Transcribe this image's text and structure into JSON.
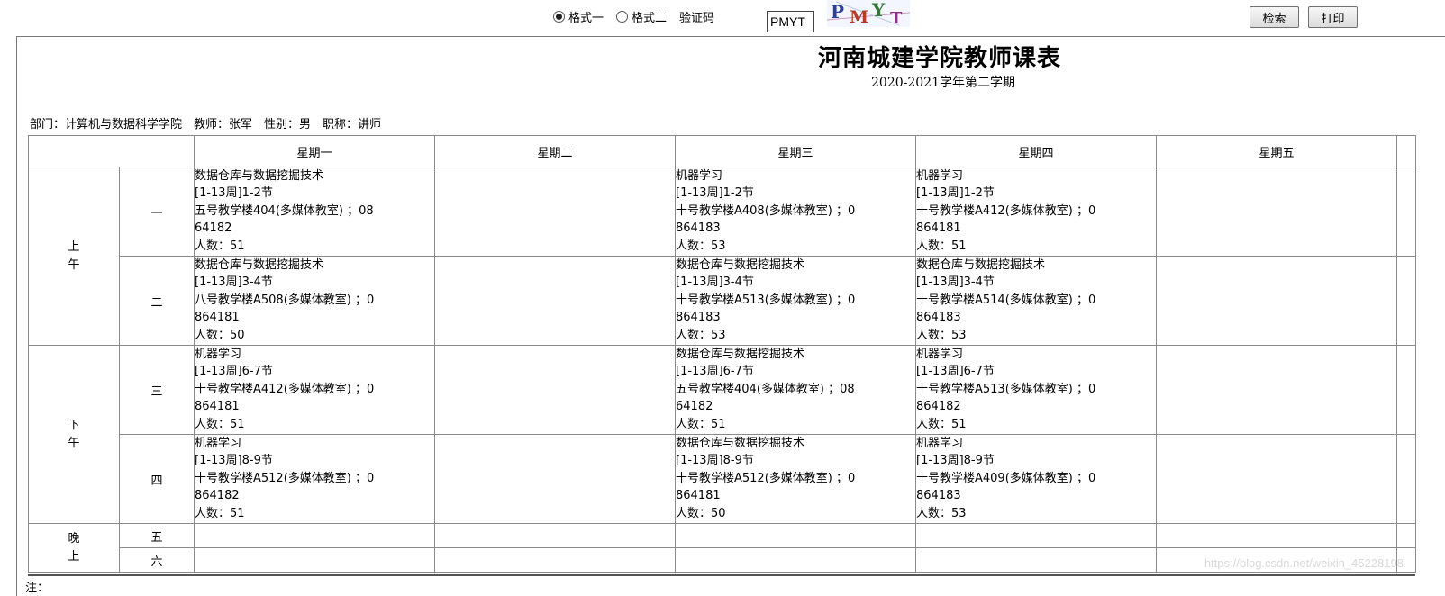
{
  "toolbar": {
    "format1_label": "格式一",
    "format2_label": "格式二",
    "captcha_label": "验证码",
    "captcha_value": "PMYT",
    "captcha_image_text": "PMYT",
    "search_label": "检索",
    "print_label": "打印"
  },
  "header": {
    "title": "河南城建学院教师课表",
    "subtitle": "2020-2021学年第二学期",
    "info": "部门：计算机与数据科学学院　教师：张军　性别：男　职称：讲师"
  },
  "table": {
    "days": [
      "星期一",
      "星期二",
      "星期三",
      "星期四",
      "星期五"
    ],
    "periods": [
      {
        "label_top": "上",
        "label_bottom": "午"
      },
      {
        "label_top": "下",
        "label_bottom": "午"
      },
      {
        "label_top": "晚",
        "label_bottom": "上"
      }
    ],
    "slots": [
      "一",
      "二",
      "三",
      "四",
      "五",
      "六"
    ],
    "cells": {
      "r1": {
        "mon": [
          "数据仓库与数据挖掘技术",
          "[1-13周]1-2节",
          "五号教学楼404(多媒体教室) ；08",
          "64182",
          "人数：51"
        ],
        "wed": [
          "机器学习",
          "[1-13周]1-2节",
          "十号教学楼A408(多媒体教室) ；0",
          "864183",
          "人数：53"
        ],
        "thu": [
          "机器学习",
          "[1-13周]1-2节",
          "十号教学楼A412(多媒体教室) ；0",
          "864181",
          "人数：51"
        ]
      },
      "r2": {
        "mon": [
          "数据仓库与数据挖掘技术",
          "[1-13周]3-4节",
          "八号教学楼A508(多媒体教室) ；0",
          "864181",
          "人数：50"
        ],
        "wed": [
          "数据仓库与数据挖掘技术",
          "[1-13周]3-4节",
          "十号教学楼A513(多媒体教室) ；0",
          "864183",
          "人数：53"
        ],
        "thu": [
          "数据仓库与数据挖掘技术",
          "[1-13周]3-4节",
          "十号教学楼A514(多媒体教室) ；0",
          "864183",
          "人数：53"
        ]
      },
      "r3": {
        "mon": [
          "机器学习",
          "[1-13周]6-7节",
          "十号教学楼A412(多媒体教室) ；0",
          "864181",
          "人数：51"
        ],
        "wed": [
          "数据仓库与数据挖掘技术",
          "[1-13周]6-7节",
          "五号教学楼404(多媒体教室) ；08",
          "64182",
          "人数：51"
        ],
        "thu": [
          "机器学习",
          "[1-13周]6-7节",
          "十号教学楼A513(多媒体教室) ；0",
          "864182",
          "人数：51"
        ]
      },
      "r4": {
        "mon": [
          "机器学习",
          "[1-13周]8-9节",
          "十号教学楼A512(多媒体教室) ；0",
          "864182",
          "人数：51"
        ],
        "wed": [
          "数据仓库与数据挖掘技术",
          "[1-13周]8-9节",
          "十号教学楼A512(多媒体教室) ；0",
          "864181",
          "人数：50"
        ],
        "thu": [
          "机器学习",
          "[1-13周]8-9节",
          "十号教学楼A409(多媒体教室) ；0",
          "864183",
          "人数：53"
        ]
      }
    }
  },
  "footer": {
    "note": "注：",
    "watermark": "https://blog.csdn.net/weixin_45228198"
  }
}
